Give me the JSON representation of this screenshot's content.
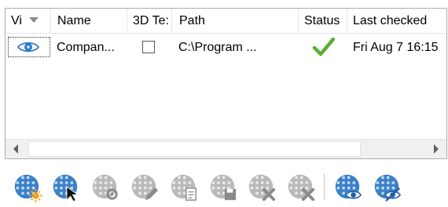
{
  "table": {
    "columns": [
      {
        "key": "visible",
        "label": "Vi"
      },
      {
        "key": "name",
        "label": "Name"
      },
      {
        "key": "text3d",
        "label": "3D Te:"
      },
      {
        "key": "path",
        "label": "Path"
      },
      {
        "key": "status",
        "label": "Status"
      },
      {
        "key": "last_checked",
        "label": "Last checked"
      }
    ],
    "rows": [
      {
        "visible": "eye-icon",
        "name": "Compan...",
        "text3d_checked": false,
        "path": "C:\\Program ...",
        "status": "checkmark-icon",
        "last_checked": "Fri Aug 7 16:15"
      }
    ]
  },
  "scrollbar": {
    "position": 0.0
  },
  "toolbar": {
    "buttons": [
      {
        "name": "add-layer-button",
        "icon": "globe-grid-sun-icon",
        "enabled": true
      },
      {
        "name": "select-layer-button",
        "icon": "globe-grid-cursor-icon",
        "enabled": true
      },
      {
        "name": "layer-settings-button",
        "icon": "globe-grid-gear-icon",
        "enabled": false
      },
      {
        "name": "edit-layer-button",
        "icon": "globe-grid-pencil-icon",
        "enabled": false
      },
      {
        "name": "layer-properties-button",
        "icon": "globe-grid-doc-icon",
        "enabled": false
      },
      {
        "name": "save-layer-button",
        "icon": "globe-grid-save-icon",
        "enabled": false
      },
      {
        "name": "remove-layer-button",
        "icon": "globe-grid-x-icon",
        "enabled": false
      },
      {
        "name": "remove-all-layers-button",
        "icon": "globe-grid-x-icon",
        "enabled": false
      },
      {
        "name": "show-layer-button",
        "icon": "globe-grid-eye-icon",
        "enabled": true
      },
      {
        "name": "toggle-visibility-button",
        "icon": "globe-grid-eye-slash-icon",
        "enabled": true
      }
    ]
  },
  "colors": {
    "accent_blue": "#2f79c5",
    "check_green": "#5aae38",
    "star_orange": "#f5a31a",
    "disabled_gray": "#b5b5b5"
  }
}
